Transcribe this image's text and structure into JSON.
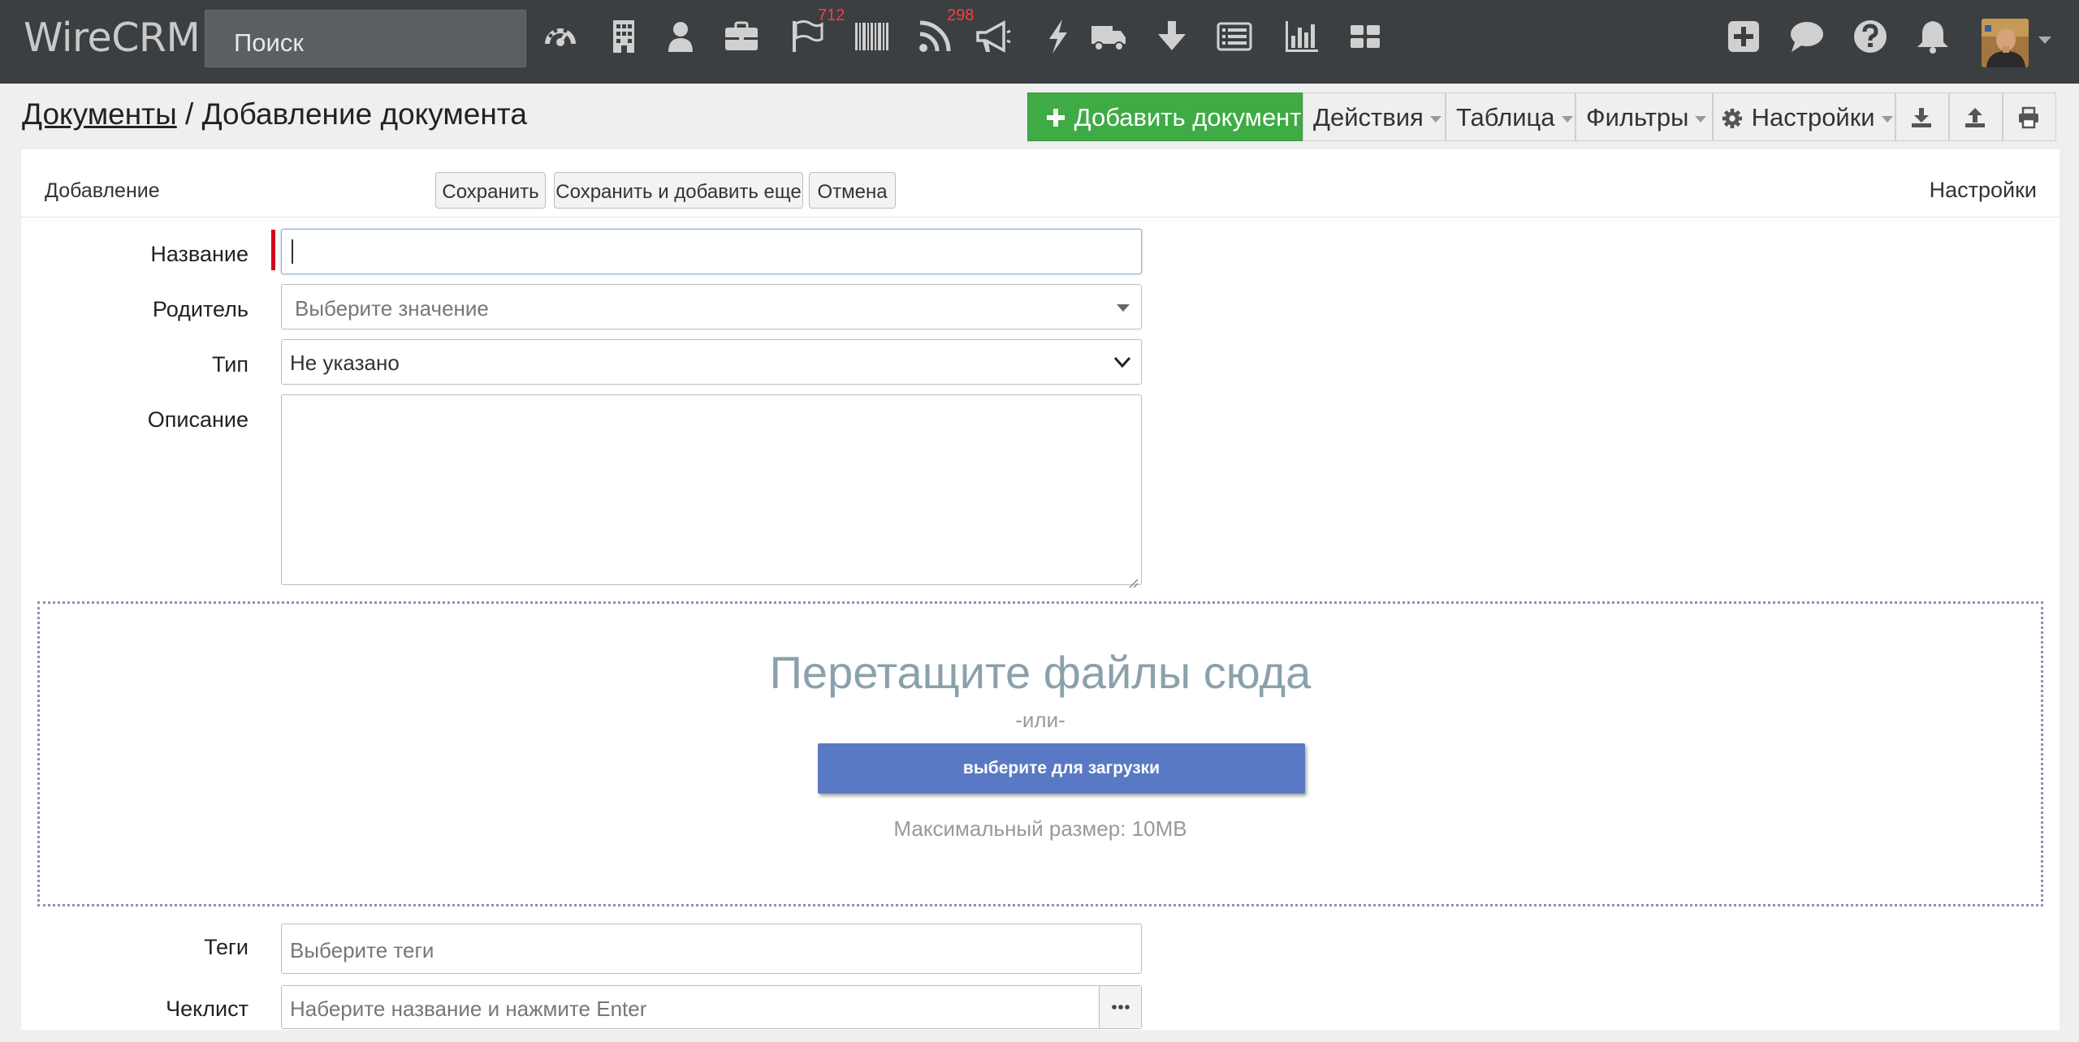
{
  "app": {
    "brand": "WireCRM",
    "search_placeholder": "Поиск",
    "badges": {
      "flag": "712",
      "rss": "298"
    },
    "nav_icons": [
      "dashboard-icon",
      "building-icon",
      "user-icon",
      "briefcase-icon",
      "flag-icon",
      "barcode-icon",
      "rss-icon",
      "megaphone-icon",
      "bolt-icon",
      "truck-icon",
      "download-arrow-icon",
      "list-icon",
      "bar-chart-icon",
      "grid-icon"
    ],
    "right_icons": [
      "plus-square-icon",
      "comment-icon",
      "question-icon",
      "bell-icon"
    ]
  },
  "header": {
    "breadcrumb_link": "Документы",
    "breadcrumb_sep": " / ",
    "breadcrumb_current": "Добавление документа",
    "add_button": "Добавить документ",
    "actions": "Действия",
    "table": "Таблица",
    "filters": "Фильтры",
    "settings": "Настройки"
  },
  "form": {
    "section_title": "Добавление",
    "save": "Сохранить",
    "save_add": "Сохранить и добавить еще",
    "cancel": "Отмена",
    "settings_link": "Настройки",
    "fields": {
      "name_label": "Название",
      "name_value": "",
      "parent_label": "Родитель",
      "parent_placeholder": "Выберите значение",
      "type_label": "Тип",
      "type_value": "Не указано",
      "description_label": "Описание",
      "description_value": "",
      "tags_label": "Теги",
      "tags_placeholder": "Выберите теги",
      "checklist_label": "Чеклист",
      "checklist_placeholder": "Наберите название и нажмите Enter"
    },
    "upload": {
      "title": "Перетащите файлы сюда",
      "or": "-или-",
      "button": "выберите для загрузки",
      "max": "Максимальный размер: 10MB"
    }
  },
  "colors": {
    "navbar": "#3b3f42",
    "add_button": "#3fab45",
    "upload_button": "#5a79c4",
    "required_marker": "#d0021b",
    "badge": "#ff3a3a"
  }
}
